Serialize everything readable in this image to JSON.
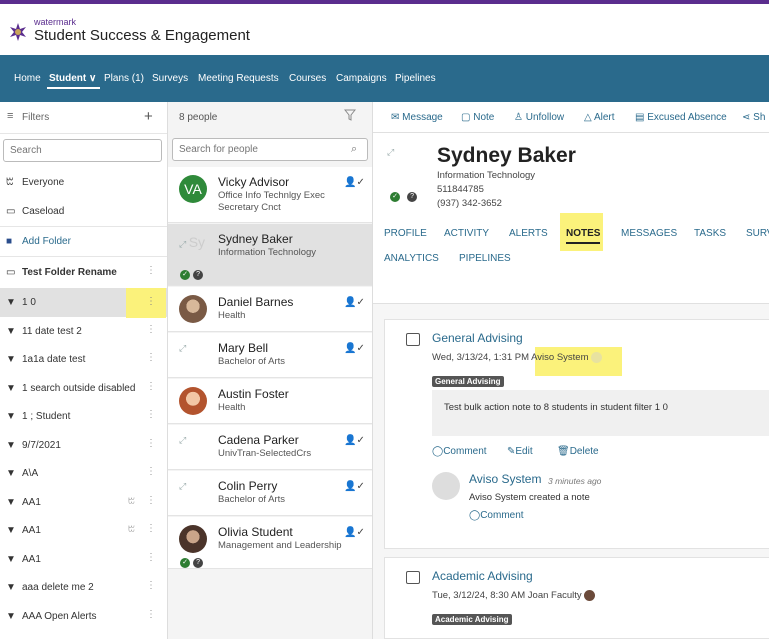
{
  "brand": {
    "watermark": "watermark",
    "product": "Student Success & Engagement"
  },
  "nav": {
    "home": "Home",
    "student": "Student ∨",
    "plans": "Plans (1)",
    "surveys": "Surveys",
    "meeting_requests": "Meeting Requests",
    "courses": "Courses",
    "campaigns": "Campaigns",
    "pipelines": "Pipelines"
  },
  "filters": {
    "header": "Filters",
    "add": "+",
    "search_placeholder": "Search",
    "everyone": "Everyone",
    "caseload": "Caseload",
    "add_folder": "Add Folder",
    "folder": "Test Folder Rename",
    "items": [
      "1 0",
      "11 date test 2",
      "1a1a date test",
      "1 search outside disabled",
      "1 ; Student",
      "9/7/2021",
      "A\\A",
      "AA1",
      "AA1",
      "AA1",
      "aaa delete me 2",
      "AAA Open Alerts"
    ]
  },
  "people": {
    "count": "8 people",
    "search_placeholder": "Search for people",
    "list": [
      {
        "initials": "VA",
        "name": "Vicky Advisor",
        "sub": "Office Info Technlgy Exec Secretary Cnct"
      },
      {
        "initials": "Sy",
        "name": "Sydney Baker",
        "sub": "Information Technology"
      },
      {
        "name": "Daniel Barnes",
        "sub": "Health"
      },
      {
        "name": "Mary Bell",
        "sub": "Bachelor of Arts"
      },
      {
        "name": "Austin Foster",
        "sub": "Health"
      },
      {
        "name": "Cadena Parker",
        "sub": "UnivTran-SelectedCrs"
      },
      {
        "name": "Colin Perry",
        "sub": "Bachelor of Arts"
      },
      {
        "name": "Olivia Student",
        "sub": "Management and Leadership"
      }
    ]
  },
  "toolbar": {
    "message": "Message",
    "note": "Note",
    "unfollow": "Unfollow",
    "alert": "Alert",
    "excused_absence": "Excused Absence",
    "share": "Sh"
  },
  "profile": {
    "name": "Sydney Baker",
    "program": "Information Technology",
    "id": "511844785",
    "phone": "(937) 342-3652"
  },
  "tabs": [
    "PROFILE",
    "ACTIVITY",
    "ALERTS",
    "NOTES",
    "MESSAGES",
    "TASKS",
    "SURV",
    "ANALYTICS",
    "PIPELINES"
  ],
  "notes": [
    {
      "title": "General Advising",
      "date": "Wed, 3/13/24, 1:31 PM",
      "author": "Aviso System",
      "tag": "General Advising",
      "body": "Test bulk action note to 8 students in student filter 1 0",
      "comment": "Comment",
      "edit": "Edit",
      "delete": "Delete",
      "reply_name": "Aviso System",
      "reply_time": "3 minutes ago",
      "reply_text": "Aviso System created a note",
      "reply_comment": "Comment"
    },
    {
      "title": "Academic Advising",
      "date": "Tue, 3/12/24, 8:30 AM",
      "author": "Joan Faculty",
      "tag": "Academic Advising"
    }
  ],
  "colors": {
    "nav": "#2a6a8c",
    "brand": "#5b2d8e",
    "highlight": "#fbf27b",
    "selected_row": "#e1e1e1"
  }
}
